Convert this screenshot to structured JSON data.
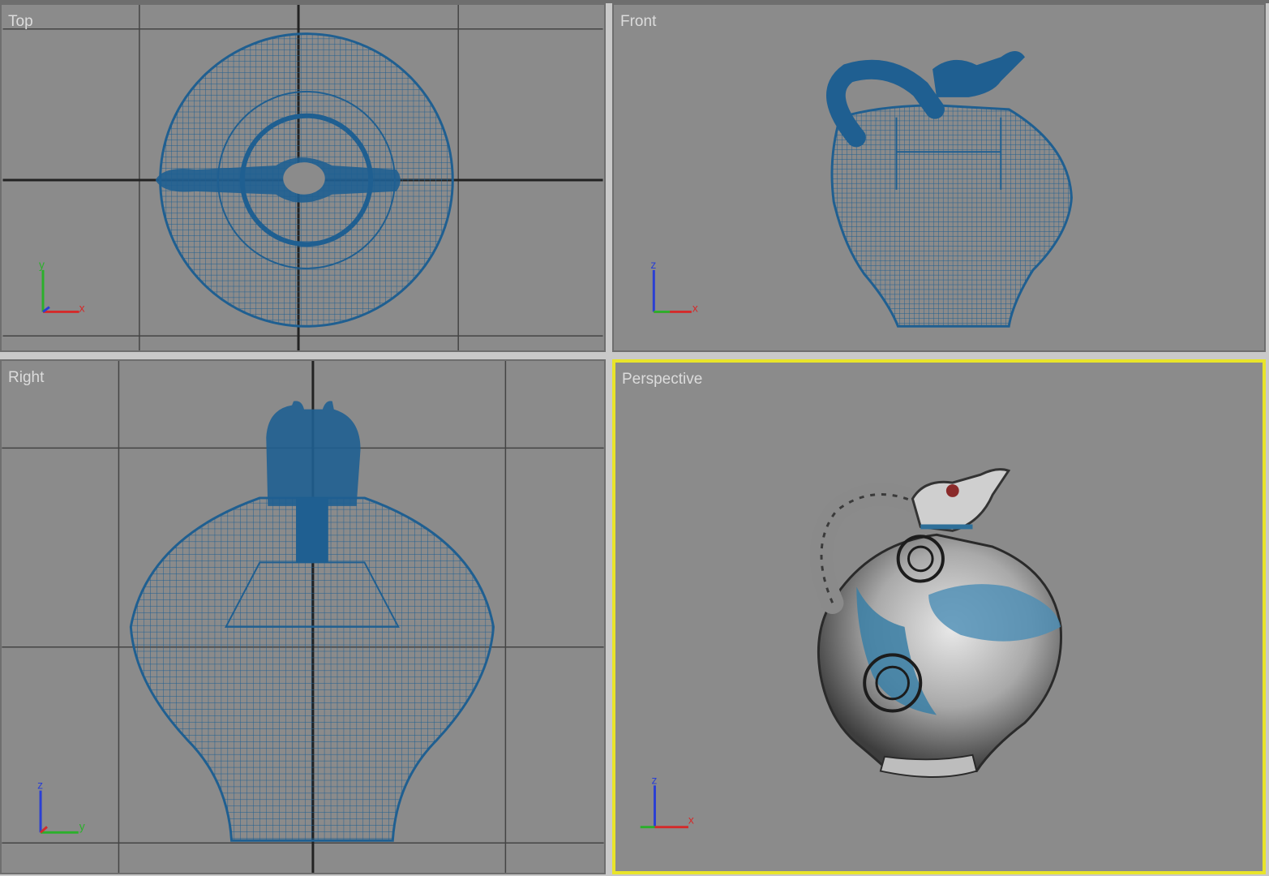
{
  "viewports": {
    "top": {
      "label": "Top",
      "axis_labels": {
        "vertical": "y",
        "horizontal": "x"
      }
    },
    "front": {
      "label": "Front",
      "axis_labels": {
        "vertical": "z",
        "horizontal": "x"
      }
    },
    "right": {
      "label": "Right",
      "axis_labels": {
        "vertical": "z",
        "horizontal": "y"
      }
    },
    "perspective": {
      "label": "Perspective",
      "axis_labels": {
        "vertical": "z",
        "horizontal": "x"
      },
      "active": true
    }
  },
  "colors": {
    "viewport_bg": "#8b8b8b",
    "wireframe": "#1f5f91",
    "active_border": "#e8e42a",
    "axis_x": "#d42a2a",
    "axis_y": "#2bb02b",
    "axis_z": "#2a3fd4"
  },
  "icons": [
    "axis-tripod-icon"
  ]
}
